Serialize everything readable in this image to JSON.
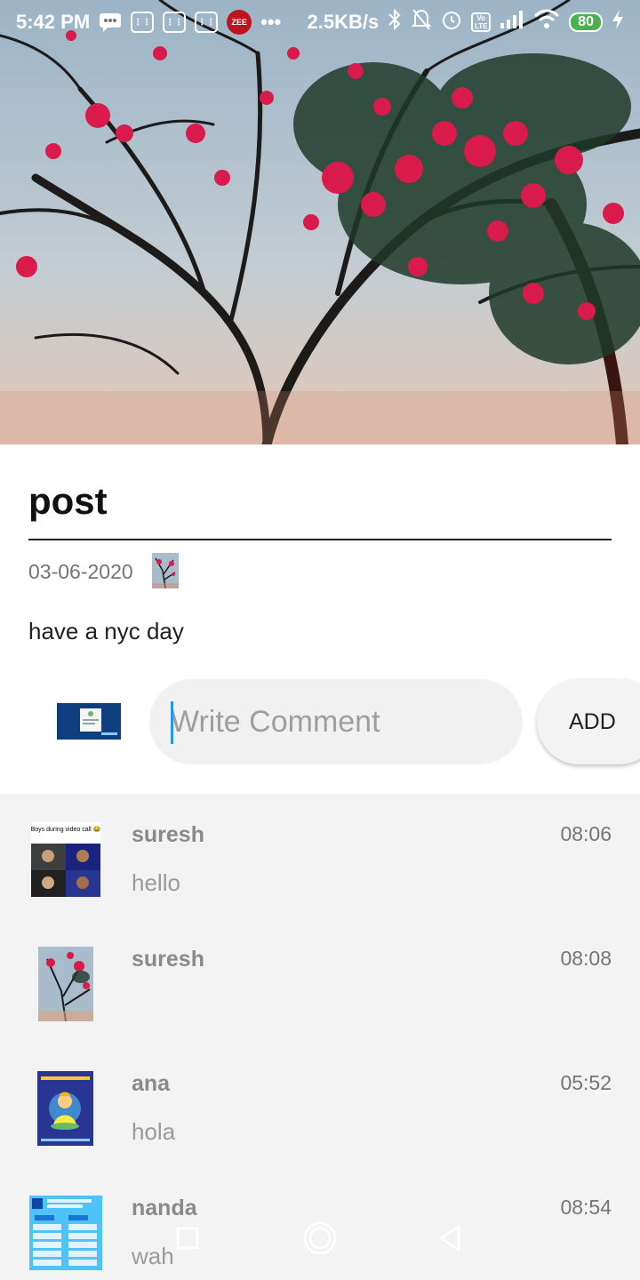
{
  "status_bar": {
    "time": "5:42 PM",
    "network_speed": "2.5KB/s",
    "battery": "80",
    "zee_label": "ZEE",
    "volte_label": "Vo LTE"
  },
  "post": {
    "title": "post",
    "date": "03-06-2020",
    "body": "have a nyc day"
  },
  "comment_box": {
    "placeholder": "Write Comment",
    "add_label": "ADD"
  },
  "comments": [
    {
      "name": "suresh",
      "text": "hello",
      "time": "08:06",
      "avatar": "meme-thumbnail",
      "avatar_caption": "Boys during video call 😂"
    },
    {
      "name": "suresh",
      "text": "",
      "time": "08:08",
      "avatar": "tree-photo-thumbnail"
    },
    {
      "name": "ana",
      "text": "hola",
      "time": "05:52",
      "avatar": "meditation-cartoon-thumbnail"
    },
    {
      "name": "nanda",
      "text": "wah",
      "time": "08:54",
      "avatar": "photoshop-cheatsheet-thumbnail"
    }
  ],
  "colors": {
    "accent": "#2196f3",
    "list_background": "#f3f3f3",
    "input_background": "#f1f1f1",
    "muted_text": "#9a9a9a"
  },
  "icons": {
    "nav": [
      "recents-square-icon",
      "home-circle-icon",
      "back-triangle-icon"
    ],
    "status": [
      "chat-icon",
      "sim-icon",
      "zee-icon",
      "bluetooth-icon",
      "mute-bell-icon",
      "alarm-icon",
      "signal-icon",
      "wifi-icon",
      "battery-icon",
      "charging-icon"
    ]
  }
}
